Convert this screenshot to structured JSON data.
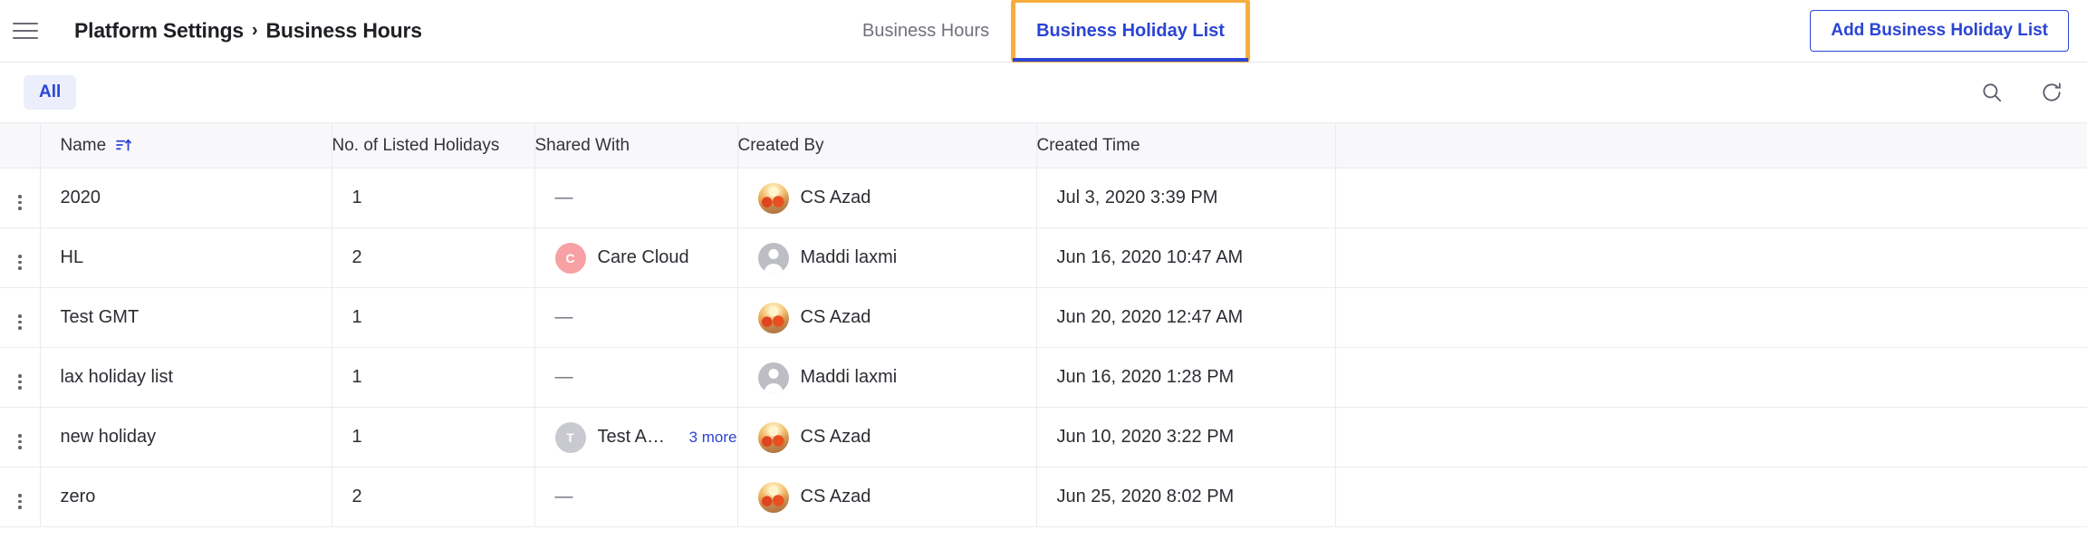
{
  "topbar": {
    "menu_icon": "hamburger-menu-icon",
    "breadcrumb": {
      "root": "Platform Settings",
      "separator": "›",
      "current": "Business Hours"
    },
    "tabs": [
      {
        "label": "Business Hours",
        "active": false
      },
      {
        "label": "Business Holiday List",
        "active": true,
        "highlighted": true
      }
    ],
    "primary_button": "Add Business Holiday List"
  },
  "filterbar": {
    "chip": "All",
    "search_icon": "search-icon",
    "refresh_icon": "refresh-icon"
  },
  "table": {
    "columns": [
      {
        "key": "name",
        "label": "Name",
        "sorted": true,
        "sort_icon": "sort-ascending-icon"
      },
      {
        "key": "count",
        "label": "No. of Listed Holidays"
      },
      {
        "key": "shared",
        "label": "Shared With"
      },
      {
        "key": "author",
        "label": "Created By"
      },
      {
        "key": "time",
        "label": "Created Time"
      }
    ],
    "rows": [
      {
        "name": "2020",
        "count": "1",
        "shared": {
          "text": "—",
          "empty": true
        },
        "author": {
          "name": "CS Azad",
          "avatar": "photo"
        },
        "time": "Jul 3, 2020 3:39 PM"
      },
      {
        "name": "HL",
        "count": "2",
        "shared": {
          "text": "Care Cloud",
          "initial": "C",
          "avatar": "pink",
          "empty": false
        },
        "author": {
          "name": "Maddi laxmi",
          "avatar": "blank"
        },
        "time": "Jun 16, 2020 10:47 AM"
      },
      {
        "name": "Test GMT",
        "count": "1",
        "shared": {
          "text": "—",
          "empty": true
        },
        "author": {
          "name": "CS Azad",
          "avatar": "photo"
        },
        "time": "Jun 20, 2020 12:47 AM"
      },
      {
        "name": "lax holiday list",
        "count": "1",
        "shared": {
          "text": "—",
          "empty": true
        },
        "author": {
          "name": "Maddi laxmi",
          "avatar": "blank"
        },
        "time": "Jun 16, 2020 1:28 PM"
      },
      {
        "name": "new holiday",
        "count": "1",
        "shared": {
          "text": "Test Audien…",
          "initial": "T",
          "avatar": "gray",
          "empty": false,
          "more": "3 more"
        },
        "author": {
          "name": "CS Azad",
          "avatar": "photo"
        },
        "time": "Jun 10, 2020 3:22 PM"
      },
      {
        "name": "zero",
        "count": "2",
        "shared": {
          "text": "—",
          "empty": true
        },
        "author": {
          "name": "CS Azad",
          "avatar": "photo"
        },
        "time": "Jun 25, 2020 8:02 PM"
      }
    ],
    "row_menu_icon": "kebab-menu-icon"
  },
  "colors": {
    "accent": "#2b44d4",
    "highlight": "#f7ad3e",
    "chip_bg": "#eceefb",
    "header_bg": "#f8f8fa",
    "border": "#ebebef",
    "avatar_pink": "#f7a1a4",
    "avatar_gray": "#c9c9d1"
  }
}
